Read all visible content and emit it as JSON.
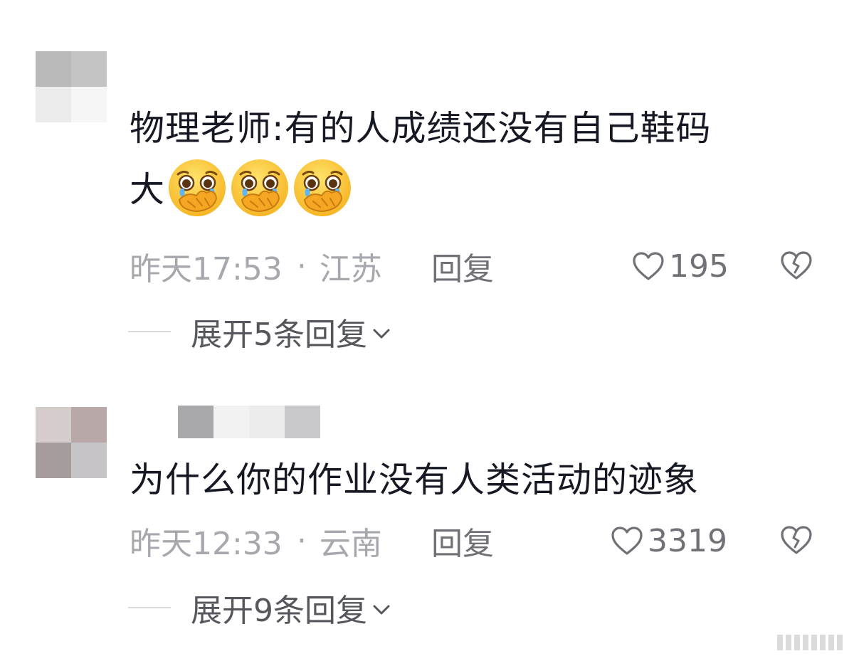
{
  "comments": [
    {
      "text": "物理老师:有的人成绩还没有自己鞋码",
      "text_line2": "大",
      "emoji_count": 3,
      "emoji_name": "crying-face-covering-mouth-emoji",
      "time": "昨天17:53",
      "separator": "·",
      "location": "江苏",
      "reply_label": "回复",
      "likes": "195",
      "expand_label": "展开5条回复"
    },
    {
      "text": "为什么你的作业没有人类活动的迹象",
      "time": "昨天12:33",
      "separator": "·",
      "location": "云南",
      "reply_label": "回复",
      "likes": "3319",
      "expand_label": "展开9条回复"
    }
  ],
  "colors": {
    "text": "#161823",
    "meta": "#a6a8ad",
    "action": "#6f7176",
    "expand": "#55575c"
  },
  "icons": {
    "like": "heart-outline-icon",
    "dislike": "broken-heart-icon",
    "expand": "chevron-down-icon"
  }
}
